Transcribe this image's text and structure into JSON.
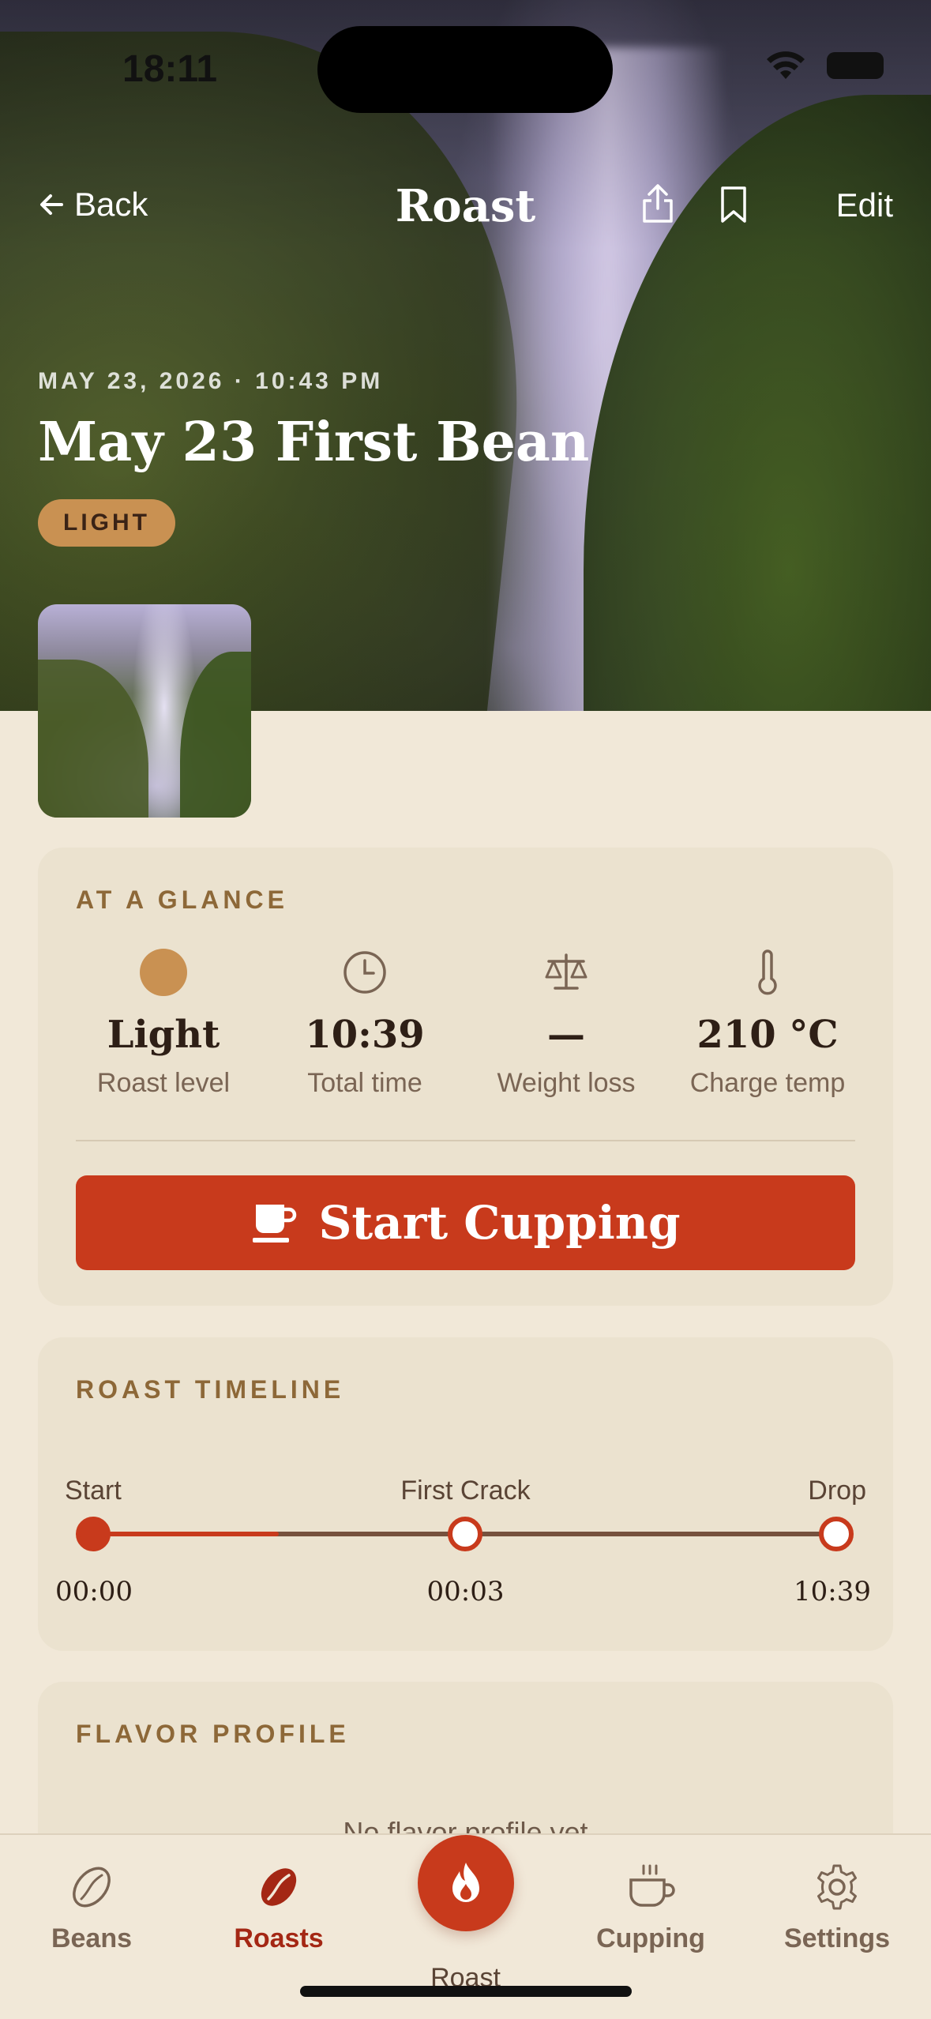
{
  "status_bar": {
    "time": "18:11"
  },
  "nav": {
    "back_label": "Back",
    "title": "Roast",
    "edit_label": "Edit"
  },
  "roast": {
    "datetime": "MAY 23, 2026 · 10:43 PM",
    "name": "May 23 First Bean",
    "badge": "LIGHT"
  },
  "glance": {
    "section_label": "AT A GLANCE",
    "stats": [
      {
        "icon": "roast-level-dot-icon",
        "value": "Light",
        "label": "Roast level"
      },
      {
        "icon": "clock-icon",
        "value": "10:39",
        "label": "Total time"
      },
      {
        "icon": "scale-icon",
        "value": "—",
        "label": "Weight loss"
      },
      {
        "icon": "thermometer-icon",
        "value": "210 °C",
        "label": "Charge temp"
      }
    ],
    "cta_label": "Start Cupping"
  },
  "timeline": {
    "section_label": "ROAST TIMELINE",
    "events": [
      {
        "label": "Start",
        "time": "00:00"
      },
      {
        "label": "First Crack",
        "time": "00:03"
      },
      {
        "label": "Drop",
        "time": "10:39"
      }
    ],
    "progress": 0.25
  },
  "flavor": {
    "section_label": "FLAVOR PROFILE",
    "empty_text": "No flavor profile yet"
  },
  "tabbar": {
    "tabs": [
      {
        "label": "Beans",
        "icon": "bean-outline-icon",
        "active": false
      },
      {
        "label": "Roasts",
        "icon": "bean-filled-icon",
        "active": true
      },
      {
        "label": "Roast",
        "icon": "flame-icon",
        "active": false
      },
      {
        "label": "Cupping",
        "icon": "cup-icon",
        "active": false
      },
      {
        "label": "Settings",
        "icon": "gear-icon",
        "active": false
      }
    ]
  },
  "colors": {
    "accent": "#c83a1c",
    "badge": "#c99152",
    "background": "#f1e8d8",
    "card": "#ebe2cf",
    "section_label": "#8d6838"
  }
}
